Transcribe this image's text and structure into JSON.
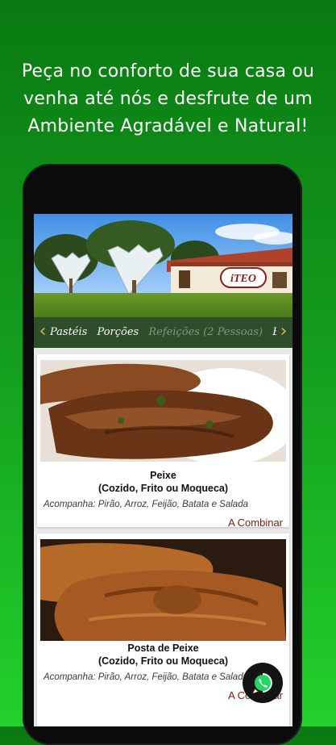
{
  "headline": {
    "line1": "Peça no conforto de sua casa ou",
    "line2": "venha até nós e desfrute de um",
    "line3": "Ambiente Agradável e Natural!"
  },
  "hero": {
    "sign_text": "iTEO"
  },
  "category_bar": {
    "prev_icon": "‹",
    "next_icon": "›",
    "tabs": [
      "Pastéis",
      "Porções",
      "Refeições (2 Pessoas)",
      "Be"
    ],
    "active_index": 2
  },
  "menu": {
    "items": [
      {
        "name_line1": "Peixe",
        "name_line2": "(Cozido, Frito ou Moqueca)",
        "description": "Acompanha: Pirão, Arroz, Feijão, Batata e Salada",
        "price": "A Combinar"
      },
      {
        "name_line1": "Posta de Peixe",
        "name_line2": "(Cozido, Frito ou Moqueca)",
        "description": "Acompanha: Pirão, Arroz, Feijão, Batata e Salada",
        "price": "A Combinar"
      }
    ]
  },
  "whatsapp": {
    "icon": "whatsapp-icon",
    "color": "#25D366"
  },
  "colors": {
    "background_top": "#0a7a12",
    "background_bottom": "#22d12c",
    "category_bar": "#2d4d2b",
    "price": "#7a1e14"
  }
}
